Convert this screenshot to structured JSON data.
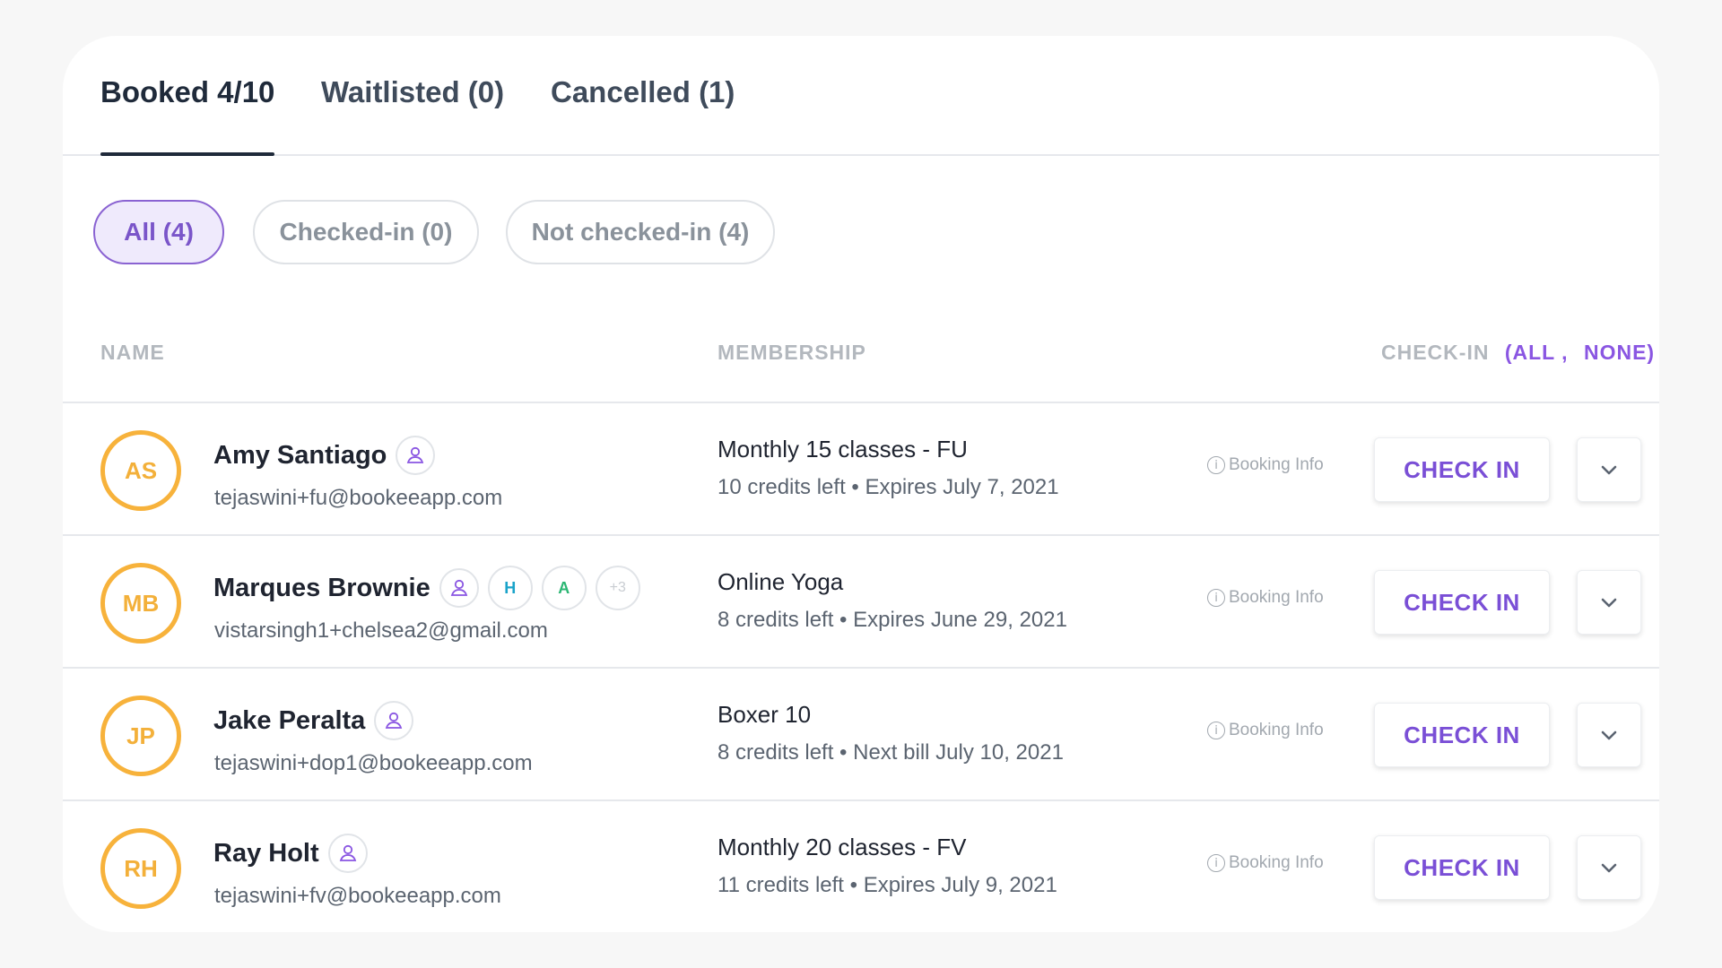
{
  "tabs": [
    {
      "label": "Booked 4/10",
      "active": true
    },
    {
      "label": "Waitlisted (0)",
      "active": false
    },
    {
      "label": "Cancelled (1)",
      "active": false
    }
  ],
  "filters": [
    {
      "label": "All (4)",
      "active": true
    },
    {
      "label": "Checked-in (0)",
      "active": false
    },
    {
      "label": "Not checked-in (4)",
      "active": false
    }
  ],
  "table_header": {
    "name": "NAME",
    "membership": "MEMBERSHIP",
    "checkin": "CHECK-IN",
    "all_link": "(ALL ,",
    "none_link": "NONE)"
  },
  "colors": {
    "accent": "#7a4fd6",
    "avatar_ring": "#f7b23b",
    "tag_h": "#1aa3c9",
    "tag_a": "#2bb673"
  },
  "booking_info_label": "Booking Info",
  "checkin_label": "CHECK IN",
  "rows": [
    {
      "initials": "AS",
      "name": "Amy Santiago",
      "email": "tejaswini+fu@bookeeapp.com",
      "plan": "Monthly 15 classes - FU",
      "credits": "10 credits left • Expires July 7, 2021",
      "tags": []
    },
    {
      "initials": "MB",
      "name": "Marques Brownie",
      "email": "vistarsingh1+chelsea2@gmail.com",
      "plan": "Online Yoga",
      "credits": "8 credits left • Expires June 29, 2021",
      "tags": [
        "H",
        "A",
        "+3"
      ]
    },
    {
      "initials": "JP",
      "name": "Jake Peralta",
      "email": "tejaswini+dop1@bookeeapp.com",
      "plan": "Boxer 10",
      "credits": "8 credits left • Next bill July 10, 2021",
      "tags": []
    },
    {
      "initials": "RH",
      "name": "Ray Holt",
      "email": "tejaswini+fv@bookeeapp.com",
      "plan": "Monthly 20 classes - FV",
      "credits": "11 credits left • Expires July 9, 2021",
      "tags": []
    }
  ]
}
